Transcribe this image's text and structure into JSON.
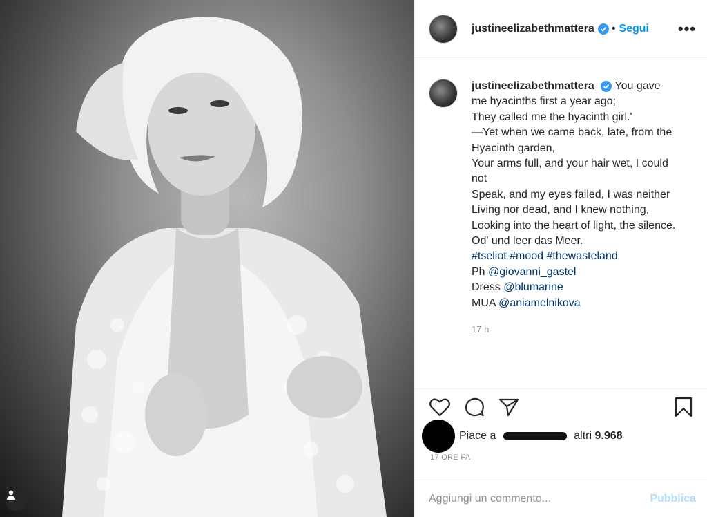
{
  "post": {
    "username": "justineelizabethmattera",
    "verified_icon": "verified-badge-icon",
    "dot": "•",
    "follow_label": "Segui",
    "more_label": "•••"
  },
  "caption": {
    "username": "justineelizabethmattera",
    "lines": [
      "You gave me hyacinths first a year ago;",
      "They called me the hyacinth girl.'",
      "—Yet when we came back, late, from the Hyacinth garden,",
      "Your arms full, and your hair wet, I could not",
      "Speak, and my eyes failed, I was neither",
      "Living nor dead, and I knew nothing,",
      "Looking into the heart of light, the silence.",
      "Od' und leer das Meer."
    ],
    "hashtags": [
      "#tseliot",
      "#mood",
      "#thewasteland"
    ],
    "credit_ph_prefix": "Ph",
    "credit_ph_handle": "@giovanni_gastel",
    "credit_dress_prefix": "Dress",
    "credit_dress_handle": "@blumarine",
    "credit_mua_prefix": "MUA",
    "credit_mua_handle": "@aniamelnikova",
    "time_ago": "17 h"
  },
  "actions": {
    "like_icon": "heart-icon",
    "comment_icon": "comment-icon",
    "share_icon": "paper-plane-icon",
    "save_icon": "bookmark-icon"
  },
  "likes": {
    "prefix": "Piace a",
    "suffix": "altri",
    "count": "9.968"
  },
  "post_date": "17 ORE FA",
  "comment": {
    "placeholder": "Aggiungi un commento...",
    "publish_label": "Pubblica"
  },
  "colors": {
    "accent": "#0095f6",
    "link": "#00376b",
    "muted": "#8e8e8e",
    "publish_disabled": "#b2dffc"
  }
}
